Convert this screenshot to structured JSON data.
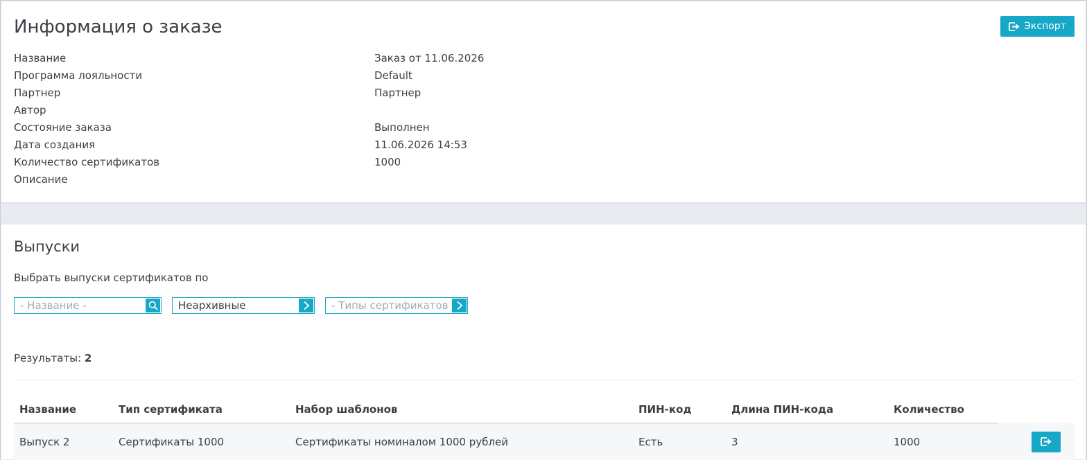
{
  "order": {
    "title": "Информация о заказе",
    "export_label": "Экспорт",
    "fields": [
      {
        "label": "Название",
        "value": "Заказ от 11.06.2026"
      },
      {
        "label": "Программа лояльности",
        "value": "Default"
      },
      {
        "label": "Партнер",
        "value": "Партнер"
      },
      {
        "label": "Автор",
        "value": ""
      },
      {
        "label": "Состояние заказа",
        "value": "Выполнен"
      },
      {
        "label": "Дата создания",
        "value": "11.06.2026 14:53"
      },
      {
        "label": "Количество сертификатов",
        "value": "1000"
      },
      {
        "label": "Описание",
        "value": ""
      }
    ]
  },
  "releases": {
    "title": "Выпуски",
    "filter_caption": "Выбрать выпуски сертификатов по",
    "filters": {
      "name_placeholder": "- Название -",
      "archive_value": "Неархивные",
      "types_placeholder": "- Типы сертификатов -"
    },
    "results_label": "Результаты:",
    "results_count": "2",
    "columns": [
      "Название",
      "Тип сертификата",
      "Набор шаблонов",
      "ПИН-код",
      "Длина ПИН-кода",
      "Количество"
    ],
    "rows": [
      [
        "Выпуск 2",
        "Сертификаты 1000",
        "Сертификаты номиналом 1000 рублей",
        "Есть",
        "3",
        "1000"
      ]
    ]
  },
  "icons": {
    "export": "export-icon",
    "search": "search-icon",
    "chevron": "chevron-right-icon"
  },
  "colors": {
    "accent": "#17a8c7",
    "background": "#e8ecf1",
    "text": "#3a3f44"
  }
}
